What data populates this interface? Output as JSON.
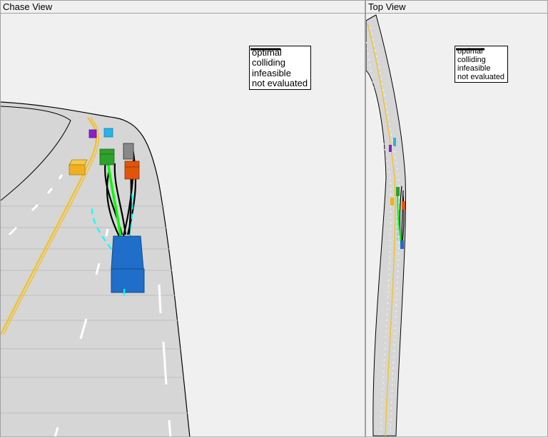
{
  "panels": {
    "chase": {
      "title": "Chase View"
    },
    "top": {
      "title": "Top View"
    }
  },
  "legend": {
    "items": [
      {
        "label": "optimal",
        "color": "#00ff00",
        "style": "solid"
      },
      {
        "label": "colliding",
        "color": "#ff0000",
        "style": "solid"
      },
      {
        "label": "infeasible",
        "color": "#00ffff",
        "style": "dashed"
      },
      {
        "label": "not evaluated",
        "color": "#000000",
        "style": "solid"
      }
    ]
  },
  "colors": {
    "road": "#d6d6d6",
    "lane_marking": "#ffffff",
    "center_line": "#f2c230",
    "ego_vehicle": "#1f6ec9",
    "vehicle_green": "#2ea12e",
    "vehicle_orange": "#e0550b",
    "vehicle_yellow": "#f0b020",
    "vehicle_purple": "#8a1fcf",
    "vehicle_cyan": "#27b4e8"
  }
}
